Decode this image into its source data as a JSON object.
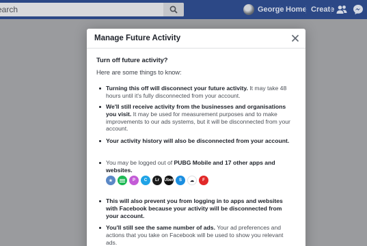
{
  "topbar": {
    "search_text": "earch",
    "user_name": "George",
    "home_label": "Home",
    "create_label": "Create"
  },
  "modal": {
    "title": "Manage Future Activity",
    "question": "Turn off future activity?",
    "intro": "Here are some things to know:",
    "bullets": [
      {
        "bold": "Turning this off will disconnect your future activity.",
        "rest": " It may take 48 hours until it's fully disconnected from your account."
      },
      {
        "bold": "We'll still receive activity from the businesses and organisations you visit.",
        "rest": " It may be used for measurement purposes and to make improvements to our ads systems, but it will be disconnected from your account."
      },
      {
        "bold": "Your activity history will also be disconnected from your account.",
        "rest": ""
      },
      {
        "pre": "You may be logged out of ",
        "bold": "PUBG Mobile and 17 other apps and websites.",
        "rest": ""
      },
      {
        "bold": "This will also prevent you from logging in to apps and websites with Facebook because your activity will be disconnected from your account.",
        "rest": ""
      },
      {
        "bold": "You'll still see the same number of ads.",
        "rest": " Your ad preferences and actions that you take on Facebook will be used to show you relevant ads."
      }
    ],
    "apps": [
      {
        "icon": "pubg-icon",
        "color": "#5a88c6",
        "text": ""
      },
      {
        "icon": "spotify-icon",
        "color": "#1db954",
        "text": ""
      },
      {
        "icon": "picsart-icon",
        "color": "#c35bd6",
        "text": "P"
      },
      {
        "icon": "canva-icon",
        "color": "#1fa3e6",
        "text": "C"
      },
      {
        "icon": "lightroom-icon",
        "color": "#1c1c1c",
        "text": "Lr"
      },
      {
        "icon": "uber-icon",
        "color": "#111111",
        "text": "Uber"
      },
      {
        "icon": "shazam-icon",
        "color": "#1a8ee0",
        "text": "S"
      },
      {
        "icon": "cloud-icon",
        "color": "#ffffff",
        "text": ""
      },
      {
        "icon": "flipboard-icon",
        "color": "#e12828",
        "text": "F"
      }
    ]
  }
}
